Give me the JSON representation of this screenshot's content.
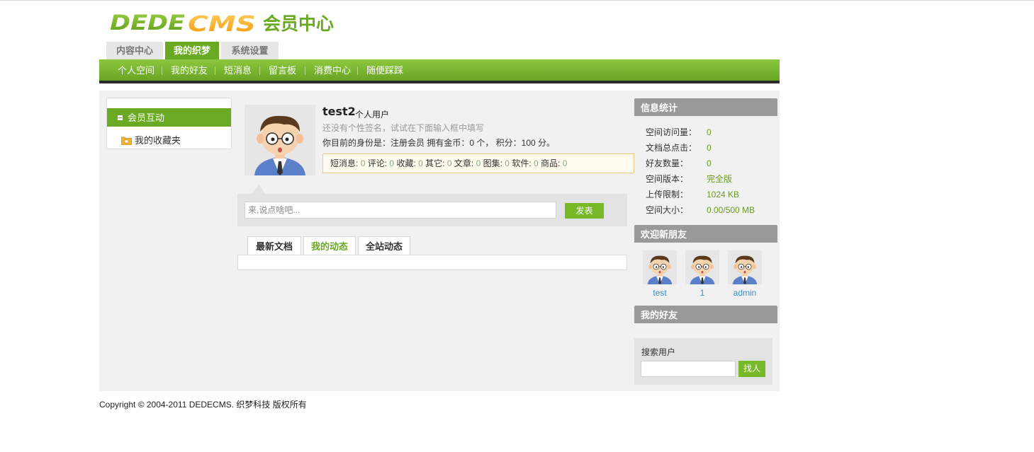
{
  "header": {
    "logo_text": "DEDECMS",
    "logo_suffix": "会员中心"
  },
  "tabs": [
    {
      "label": "内容中心"
    },
    {
      "label": "我的织梦"
    },
    {
      "label": "系统设置"
    }
  ],
  "subnav": [
    {
      "label": "个人空间"
    },
    {
      "label": "我的好友"
    },
    {
      "label": "短消息"
    },
    {
      "label": "留言板"
    },
    {
      "label": "消费中心"
    },
    {
      "label": "随便踩踩"
    }
  ],
  "sidebar": {
    "group_label": "会员互动",
    "items": [
      {
        "label": "我的收藏夹"
      }
    ]
  },
  "profile": {
    "username": "test2",
    "user_type": "个人用户",
    "signature": "还没有个性签名，试试在下面输入框中填写",
    "identity": "你目前的身份是：注册会员 拥有金币：0 个， 积分：100 分。",
    "stats": [
      {
        "label": "短消息:",
        "value": "0"
      },
      {
        "label": "评论:",
        "value": "0"
      },
      {
        "label": "收藏:",
        "value": "0"
      },
      {
        "label": "其它:",
        "value": "0"
      },
      {
        "label": "文章:",
        "value": "0"
      },
      {
        "label": "图集:",
        "value": "0"
      },
      {
        "label": "软件:",
        "value": "0"
      },
      {
        "label": "商品:",
        "value": "0"
      }
    ]
  },
  "post": {
    "placeholder": "来,说点啥吧...",
    "submit_label": "发表"
  },
  "feed_tabs": [
    {
      "label": "最新文档"
    },
    {
      "label": "我的动态"
    },
    {
      "label": "全站动态"
    }
  ],
  "info_stats": {
    "title": "信息统计",
    "rows": [
      {
        "label": "空间访问量：",
        "value": "0"
      },
      {
        "label": "文档总点击：",
        "value": "0"
      },
      {
        "label": "好友数量：",
        "value": "0"
      },
      {
        "label": "空间版本：",
        "value": "完全版"
      },
      {
        "label": "上传限制：",
        "value": "1024 KB"
      },
      {
        "label": "空间大小：",
        "value": "0.00/500 MB"
      }
    ]
  },
  "new_friends": {
    "title": "欢迎新朋友",
    "users": [
      {
        "name": "test"
      },
      {
        "name": "1"
      },
      {
        "name": "admin"
      }
    ]
  },
  "my_friends": {
    "title": "我的好友"
  },
  "user_search": {
    "label": "搜索用户",
    "value": "",
    "button_label": "找人"
  },
  "footer": {
    "copyright": "Copyright © 2004-2011 DEDECMS. 织梦科技 版权所有"
  },
  "colors": {
    "brand_green": "#6aaa23",
    "nav_dark": "#2b2b2b",
    "panel_gray": "#999999",
    "link_blue": "#3a8fc0"
  }
}
